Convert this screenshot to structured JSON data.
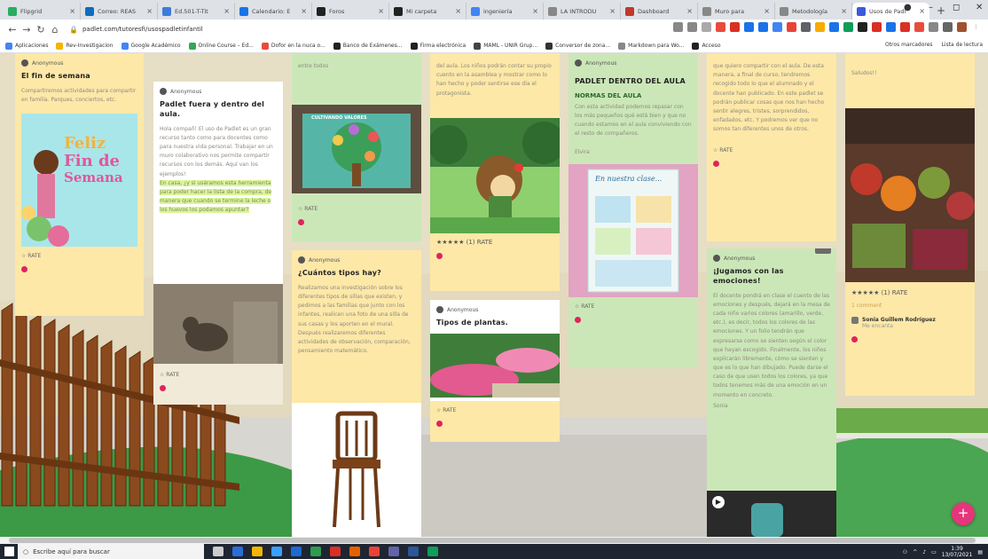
{
  "tabs": [
    {
      "label": "Flipgrid",
      "color": "#27ae60"
    },
    {
      "label": "Correo: REAS",
      "color": "#0f6cbd"
    },
    {
      "label": "Ed.501-T-Tit",
      "color": "#3b7dd8"
    },
    {
      "label": "Calendario: E",
      "color": "#1a73e8"
    },
    {
      "label": "Foros",
      "color": "#222"
    },
    {
      "label": "Mi carpeta",
      "color": "#222"
    },
    {
      "label": "ingeniería",
      "color": "#4285f4"
    },
    {
      "label": "LA INTRODU",
      "color": "#888"
    },
    {
      "label": "Dashboard",
      "color": "#c0392b"
    },
    {
      "label": "Muro para",
      "color": "#888"
    },
    {
      "label": "Metodología",
      "color": "#888"
    },
    {
      "label": "Usos de Padl",
      "color": "#3b5bdb"
    }
  ],
  "new_tab": "+",
  "window": {
    "minimize": "–",
    "maximize": "◻",
    "close": "✕"
  },
  "address": {
    "url": "padlet.com/tutoresfi/usospadletinfantil"
  },
  "bookmarks": [
    {
      "label": "Aplicaciones",
      "color": "#4285f4"
    },
    {
      "label": "Rev-Investigacion",
      "color": "#f4b400"
    },
    {
      "label": "Google Académico",
      "color": "#4285f4"
    },
    {
      "label": "Online Course – Ed...",
      "color": "#34a853"
    },
    {
      "label": "Dofor en la nuca o...",
      "color": "#e84c3d"
    },
    {
      "label": "Banco de Exámenes...",
      "color": "#222"
    },
    {
      "label": "Firma electrónica",
      "color": "#222"
    },
    {
      "label": "MAML - UNIR Grup...",
      "color": "#444"
    },
    {
      "label": "Conversor de zona...",
      "color": "#333"
    },
    {
      "label": "Markdown para Wo...",
      "color": "#888"
    },
    {
      "label": "Acceso",
      "color": "#222"
    }
  ],
  "bookmarks_right": {
    "other": "Otros marcadores",
    "reading": "Lista de lectura"
  },
  "padlet": {
    "author": "Anonymous",
    "rate": "RATE",
    "c1": {
      "title": "El fin de semana",
      "body": "Compartiremos actividades para compartir en familia. Parques, conciertos, etc.",
      "image_text": [
        "Feliz",
        "Fin de",
        "Semana"
      ]
    },
    "c2": {
      "title": "Padlet fuera y dentro del aula.",
      "body": "Hola compañ! El uso de Padlet es un gran recurso tanto como para docentes como para nuestra vida personal. Trabajar en un muro colaborativo nos permite compartir recursos con los demás. Aquí van los ejemplos!",
      "highlight": "En casa, ¿y si usáramos esta herramienta para poder hacer la lista de la compra, de manera que cuando se termine la leche o los huevos los podamos apuntar?"
    },
    "c3": {
      "top_text": "entre todos",
      "poster": "CULTIVANDO VALORES",
      "title": "¿Cuántos tipos hay?",
      "body": "Realizamos una investigación sobre los diferentes tipos de sillas que existen, y pedimos a las familias que junto con los infantes, realicen una foto de una silla de sus casas y los aporten en el mural. Después realizaremos diferentes actividades de observación, comparación, pensamiento matemático."
    },
    "c4": {
      "top_text": "del aula. Los niños podrán contar su propio cuento en la asamblea y mostrar como lo han hecho y poder sentirse ese día el protagonista.",
      "stars": "★★★★★",
      "star_count": "(1)",
      "title": "Tipos de plantas."
    },
    "c5": {
      "title": "PADLET DENTRO DEL AULA",
      "subtitle": "NORMAS DEL AULA",
      "body": "Con esta actividad podemos repasar con los más pequeños qué está bien y que no cuando estamos en el aula conviviendo con el resto de compañeros.",
      "sign": "Elvira",
      "image_text": "En nuestra clase..."
    },
    "c6": {
      "top_text": "que quiero compartir con el aula. De esta manera, a final de curso, tendremos recogido todo lo que el alumnado y el docente han publicado. En este padlet se podrán publicar cosas que nos han hecho sentir alegres, tristes, sorprendidos, enfadados, etc. Y podremos ver que no somos tan diferentes unos de otros.",
      "badge": "1",
      "title": "¡Jugamos con las emociones!",
      "body": "El docente pondrá en clase el cuento de las emociones y después, dejará en la mesa de cada niño varios colores (amarillo, verde, etc.), es decir, todos los colores de las emociones. Y un folio tendrán que expresarse como se sienten según el color que hayan escogido. Finalmente, los niños explicarán libremente, cómo se sienten y que es lo que han dibujado. Puede darse el caso de que usen todos los colores, ya que todos tenemos más de una emoción en un momento en concreto.",
      "sign": "Sonia"
    },
    "c7": {
      "top_text": "Saludos!!",
      "stars": "★★★★★",
      "star_count": "(1)",
      "comments": "1 comment",
      "commenter": "Sonia Guillem Rodríguez",
      "comment_text": "Me encanta"
    }
  },
  "fab": "+",
  "taskbar": {
    "search_placeholder": "Escribe aquí para buscar",
    "time": "1:39",
    "date": "13/07/2021"
  }
}
